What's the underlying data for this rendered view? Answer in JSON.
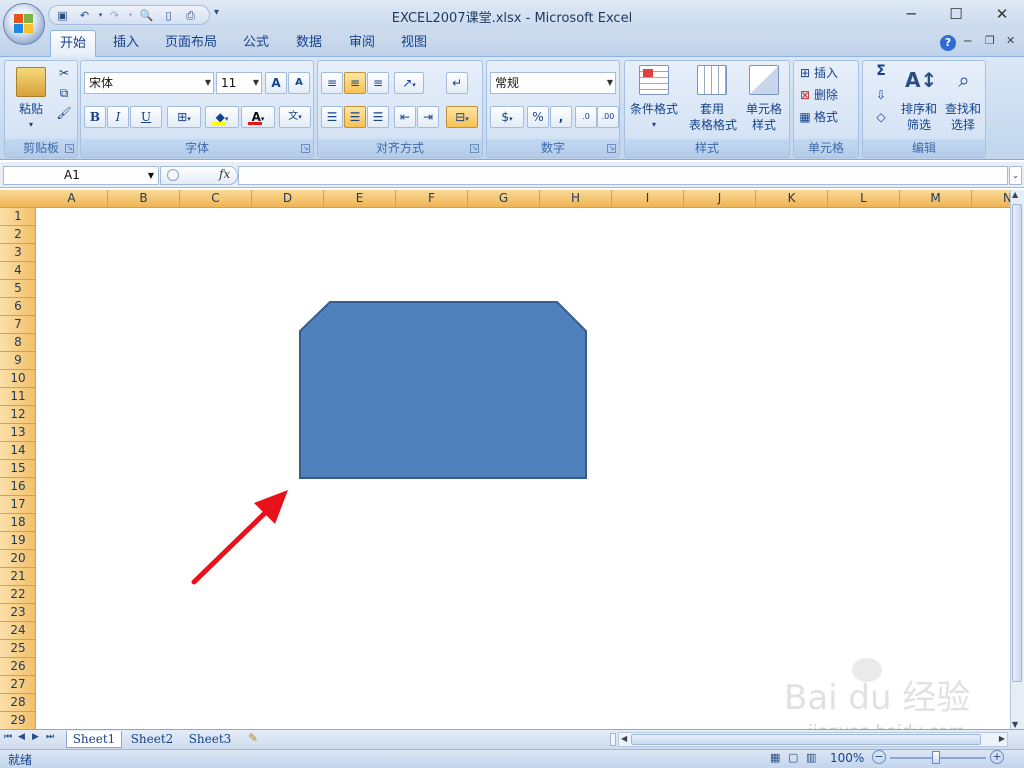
{
  "window": {
    "title": "EXCEL2007课堂.xlsx - Microsoft Excel",
    "minimize": "─",
    "maximize": "☐",
    "close": "✕"
  },
  "qat": {
    "items": [
      "save",
      "undo",
      "redo",
      "print-preview",
      "new",
      "print"
    ],
    "customize": "▾"
  },
  "tabs": [
    "开始",
    "插入",
    "页面布局",
    "公式",
    "数据",
    "审阅",
    "视图"
  ],
  "ribbon": {
    "clipboard": {
      "label": "剪贴板",
      "paste": "粘贴"
    },
    "font": {
      "label": "字体",
      "font_name": "宋体",
      "font_size": "11",
      "grow": "A",
      "shrink": "A",
      "bold": "B",
      "italic": "I",
      "underline": "U"
    },
    "alignment": {
      "label": "对齐方式"
    },
    "number": {
      "label": "数字",
      "format": "常规",
      "percent": "%",
      "comma": ",",
      "inc_decimal": "←.0\n.00",
      "dec_decimal": ".00\n→.0"
    },
    "styles": {
      "label": "样式",
      "conditional": "条件格式",
      "table_line1": "套用",
      "table_line2": "表格格式",
      "cell_line1": "单元格",
      "cell_line2": "样式"
    },
    "cells": {
      "label": "单元格",
      "insert": "插入",
      "delete": "删除",
      "format": "格式"
    },
    "editing": {
      "label": "编辑",
      "sigma": "Σ",
      "sort_line1": "排序和",
      "sort_line2": "筛选",
      "find_line1": "查找和",
      "find_line2": "选择"
    }
  },
  "formula_bar": {
    "name_box": "A1",
    "fx": "fx",
    "value": ""
  },
  "columns": [
    "A",
    "B",
    "C",
    "D",
    "E",
    "F",
    "G",
    "H",
    "I",
    "J",
    "K",
    "L",
    "M",
    "N"
  ],
  "rows": [
    "1",
    "2",
    "3",
    "4",
    "5",
    "6",
    "7",
    "8",
    "9",
    "10",
    "11",
    "12",
    "13",
    "14",
    "15",
    "16",
    "17",
    "18",
    "19",
    "20",
    "21",
    "22",
    "23",
    "24",
    "25",
    "26",
    "27",
    "28",
    "29"
  ],
  "sheets": [
    "Sheet1",
    "Sheet2",
    "Sheet3"
  ],
  "status": {
    "ready": "就绪",
    "zoom": "100%"
  },
  "colors": {
    "shape_fill": "#4f81bd",
    "shape_stroke": "#385d8a",
    "arrow": "#e8121b",
    "header_orange": "#f2c06a"
  },
  "watermark": {
    "brand": "Bai du 经验",
    "url": "jingyan.baidu.com"
  }
}
